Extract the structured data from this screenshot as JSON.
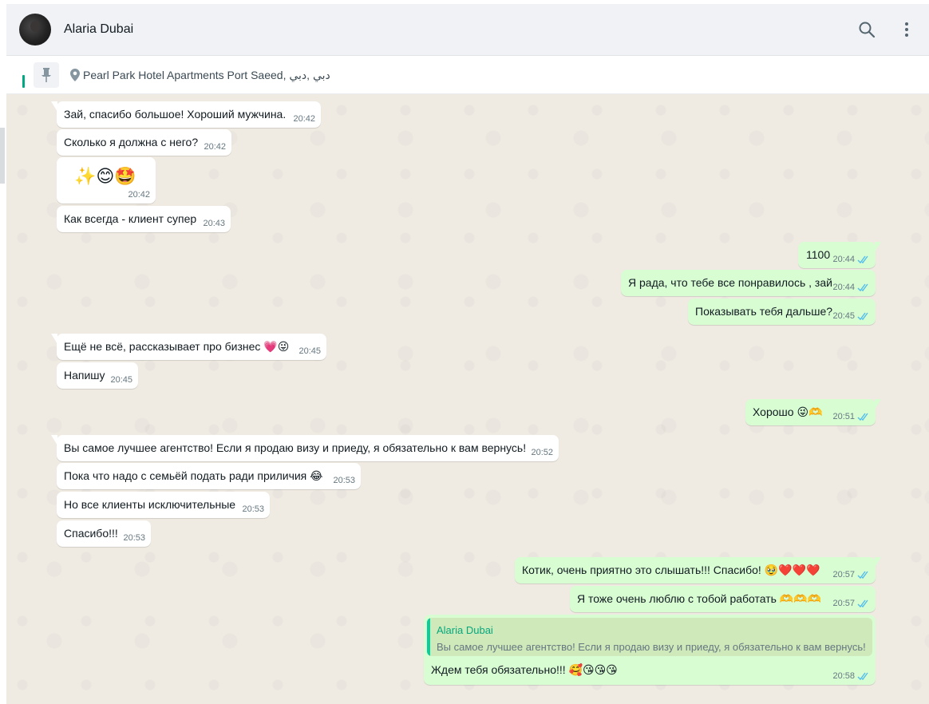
{
  "header": {
    "contact_name": "Alaria Dubai",
    "icons": [
      "search-icon",
      "menu-dots-icon"
    ]
  },
  "pinned": {
    "location": "Pearl Park Hotel Apartments Port Saeed, دبي ,دبي",
    "icons": [
      "pin-icon",
      "location-icon"
    ]
  },
  "messages": [
    {
      "dir": "in",
      "text": "Зай, спасибо большое! Хороший мужчина.",
      "time": "20:42"
    },
    {
      "dir": "in",
      "text": "Сколько я должна с него?",
      "time": "20:42"
    },
    {
      "dir": "in",
      "text": "✨😊🤩",
      "time": "20:42"
    },
    {
      "dir": "in",
      "text": "Как всегда - клиент супер",
      "time": "20:43"
    },
    {
      "dir": "out",
      "text": "1100",
      "time": "20:44"
    },
    {
      "dir": "out",
      "text": "Я рада, что тебе все понравилось , зай",
      "time": "20:44"
    },
    {
      "dir": "out",
      "text": "Показывать тебя дальше?",
      "time": "20:45"
    },
    {
      "dir": "in",
      "text": "Ещё не всё, рассказывает про бизнес 💗😜",
      "time": "20:45"
    },
    {
      "dir": "in",
      "text": "Напишу",
      "time": "20:45"
    },
    {
      "dir": "out",
      "text": "Хорошо 😜🫶",
      "time": "20:51"
    },
    {
      "dir": "in",
      "text": "Вы самое лучшее агентство! Если я продаю визу и приеду, я обязательно к вам вернусь!",
      "time": "20:52"
    },
    {
      "dir": "in",
      "text": "Пока что надо с семьёй подать ради приличия 😂",
      "time": "20:53"
    },
    {
      "dir": "in",
      "text": "Но все клиенты исключительные",
      "time": "20:53"
    },
    {
      "dir": "in",
      "text": "Спасибо!!!",
      "time": "20:53"
    },
    {
      "dir": "out",
      "text": "Котик, очень приятно это слышать!!! Спасибо! 🥹❤️❤️❤️",
      "time": "20:57"
    },
    {
      "dir": "out",
      "text": "Я тоже очень люблю с тобой работать 🫶🫶🫶",
      "time": "20:57"
    },
    {
      "dir": "out",
      "text": "Ждем тебя обязательно!!! 🥰😘😘😘",
      "time": "20:58",
      "quote": {
        "name": "Alaria Dubai",
        "text": "Вы самое лучшее агентство! Если я продаю визу и приеду, я обязательно к вам вернусь!"
      }
    }
  ],
  "colors": {
    "chat_bg": "#efeae2",
    "incoming": "#ffffff",
    "outgoing": "#d9fdd3",
    "read_ticks": "#53bdeb",
    "accent": "#00a884"
  }
}
